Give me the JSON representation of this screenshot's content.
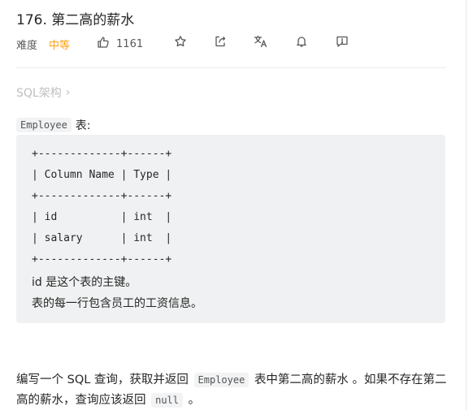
{
  "problem": {
    "title": "176. 第二高的薪水",
    "difficulty_label": "难度",
    "difficulty_value": "中等",
    "likes": "1161"
  },
  "toolbar": {
    "icons": [
      "thumbs-up-icon",
      "star-icon",
      "share-icon",
      "translate-icon",
      "bell-icon",
      "feedback-icon"
    ]
  },
  "breadcrumb": {
    "category": "SQL架构",
    "chevron": "›"
  },
  "table_intro": {
    "table_name": "Employee",
    "suffix": "表:"
  },
  "schema_block": {
    "lines": [
      "+-------------+------+",
      "| Column Name | Type |",
      "+-------------+------+",
      "| id          | int  |",
      "| salary      | int  |",
      "+-------------+------+"
    ],
    "notes": [
      "id 是这个表的主键。",
      "表的每一行包含员工的工资信息。"
    ]
  },
  "description": {
    "part1": "编写一个 SQL 查询，获取并返回",
    "code1": "Employee",
    "part2": "表中第二高的薪水 。如果不存在第二高的薪水，查询应该返回",
    "code2": "null",
    "part3": "。"
  },
  "colors": {
    "difficulty_medium": "#ffa116",
    "text_primary": "#262626",
    "text_muted": "#bfbfbf",
    "code_bg": "#f0f1f2"
  }
}
